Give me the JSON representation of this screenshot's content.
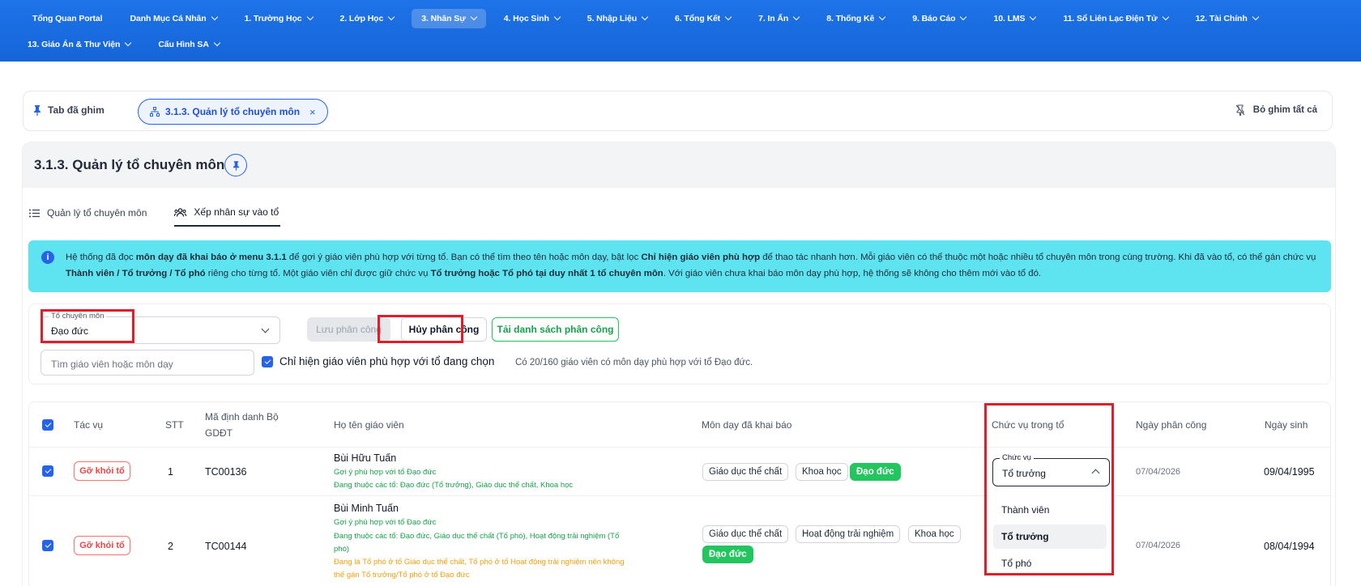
{
  "nav": {
    "row1": [
      {
        "label": "Tổng Quan Portal",
        "dropdown": false
      },
      {
        "label": "Danh Mục Cá Nhân",
        "dropdown": true
      },
      {
        "label": "1. Trường Học",
        "dropdown": true
      },
      {
        "label": "2. Lớp Học",
        "dropdown": true
      },
      {
        "label": "3. Nhân Sự",
        "dropdown": true,
        "active": true
      },
      {
        "label": "4. Học Sinh",
        "dropdown": true
      },
      {
        "label": "5. Nhập Liệu",
        "dropdown": true
      },
      {
        "label": "6. Tổng Kết",
        "dropdown": true
      },
      {
        "label": "7. In Ấn",
        "dropdown": true
      },
      {
        "label": "8. Thống Kê",
        "dropdown": true
      },
      {
        "label": "9. Báo Cáo",
        "dropdown": true
      },
      {
        "label": "10. LMS",
        "dropdown": true
      },
      {
        "label": "11. Sổ Liên Lạc Điện Tử",
        "dropdown": true
      },
      {
        "label": "12. Tài Chính",
        "dropdown": true
      }
    ],
    "row2": [
      {
        "label": "13. Giáo Án & Thư Viện",
        "dropdown": true
      },
      {
        "label": "Cấu Hình SA",
        "dropdown": true
      }
    ]
  },
  "pinned": {
    "label": "Tab đã ghim",
    "chip_label": "3.1.3. Quản lý tổ chuyên môn",
    "chip_close": "×",
    "unpin_all": "Bỏ ghim tất cả"
  },
  "page": {
    "title": "3.1.3. Quản lý tổ chuyên môn",
    "tabs": [
      {
        "label": "Quản lý tổ chuyên môn",
        "icon": "list-icon"
      },
      {
        "label": "Xếp nhân sự vào tổ",
        "icon": "users-icon",
        "active": true
      }
    ]
  },
  "info": {
    "p1": "Hệ thống đã đọc ",
    "b1": "môn dạy đã khai báo ở menu 3.1.1",
    "p2": " để gợi ý giáo viên phù hợp với từng tổ. Bạn có thể tìm theo tên hoặc môn dạy, bật lọc ",
    "b2": "Chỉ hiện giáo viên phù hợp",
    "p3": " để thao tác nhanh hơn. Mỗi giáo viên có thể thuộc một hoặc nhiều tổ chuyên môn trong cùng trường. Khi đã vào tổ, có thể gán chức vụ ",
    "b3": "Thành viên / Tổ trưởng / Tổ phó",
    "p4": " riêng cho từng tổ. Một giáo viên chỉ được giữ chức vụ ",
    "b4": "Tổ trưởng hoặc Tổ phó tại duy nhất 1 tổ chuyên môn",
    "p5": ". Với giáo viên chưa khai báo môn dạy phù hợp, hệ thống sẽ không cho thêm mới vào tổ đó."
  },
  "filters": {
    "group_legend": "Tổ chuyên môn",
    "group_value": "Đạo đức",
    "save_label": "Lưu phân công",
    "cancel_label": "Hủy phân công",
    "download_label": "Tải danh sách phân công",
    "search_placeholder": "Tìm giáo viên hoặc môn dạy",
    "only_matching_label": "Chỉ hiện giáo viên phù hợp với tổ đang chọn",
    "count_text": "Có 20/160 giáo viên có môn dạy phù hợp với tổ Đạo đức."
  },
  "table": {
    "headers": {
      "action": "Tác vụ",
      "stt": "STT",
      "code_l1": "Mã định danh Bộ",
      "code_l2": "GDĐT",
      "name": "Họ tên giáo viên",
      "subjects": "Môn dạy đã khai báo",
      "role": "Chức vụ trong tổ",
      "assign_date": "Ngày phân công",
      "dob": "Ngày sinh"
    },
    "remove_label": "Gỡ khỏi tổ",
    "rows": [
      {
        "stt": "1",
        "code": "TC00136",
        "name": "Bùi Hữu Tuấn",
        "hint": "Gợi ý phù hợp với tổ Đạo đức",
        "groups": "Đang thuộc các tổ: Đạo đức (Tổ trưởng), Giáo dục thể chất, Khoa học",
        "subjects": [
          "Giáo dục thể chất",
          "Khoa học",
          "Đạo đức"
        ],
        "assign_date": "07/04/2026",
        "dob": "09/04/1995"
      },
      {
        "stt": "2",
        "code": "TC00144",
        "name": "Bùi Minh Tuấn",
        "hint": "Gợi ý phù hợp với tổ Đạo đức",
        "groups_l1": "Đang thuộc các tổ: Đạo đức, Giáo dục thể chất (Tổ phó), Hoạt động trải nghiệm (Tổ",
        "groups_l2": "phó)",
        "warn_l1": "Đang là Tổ phó ở tổ Giáo dục thể chất, Tổ phó ở tổ Hoạt động trải nghiệm nên không",
        "warn_l2": "thể gán Tổ trưởng/Tổ phó ở tổ Đạo đức",
        "subjects": [
          "Giáo dục thể chất",
          "Hoạt động trải nghiệm",
          "Khoa học",
          "Đạo đức"
        ],
        "assign_date": "07/04/2026",
        "dob": "08/04/1994"
      }
    ]
  },
  "role_dropdown": {
    "legend": "Chức vụ",
    "value": "Tổ trưởng",
    "options": [
      "Thành viên",
      "Tổ trưởng",
      "Tổ phó"
    ],
    "selected_index": 1
  },
  "colors": {
    "nav_bg": "#1e73e8",
    "info_bg": "#5ee4f0",
    "highlight": "#e11d2a",
    "success": "#22c55e",
    "danger": "#ef4444"
  }
}
